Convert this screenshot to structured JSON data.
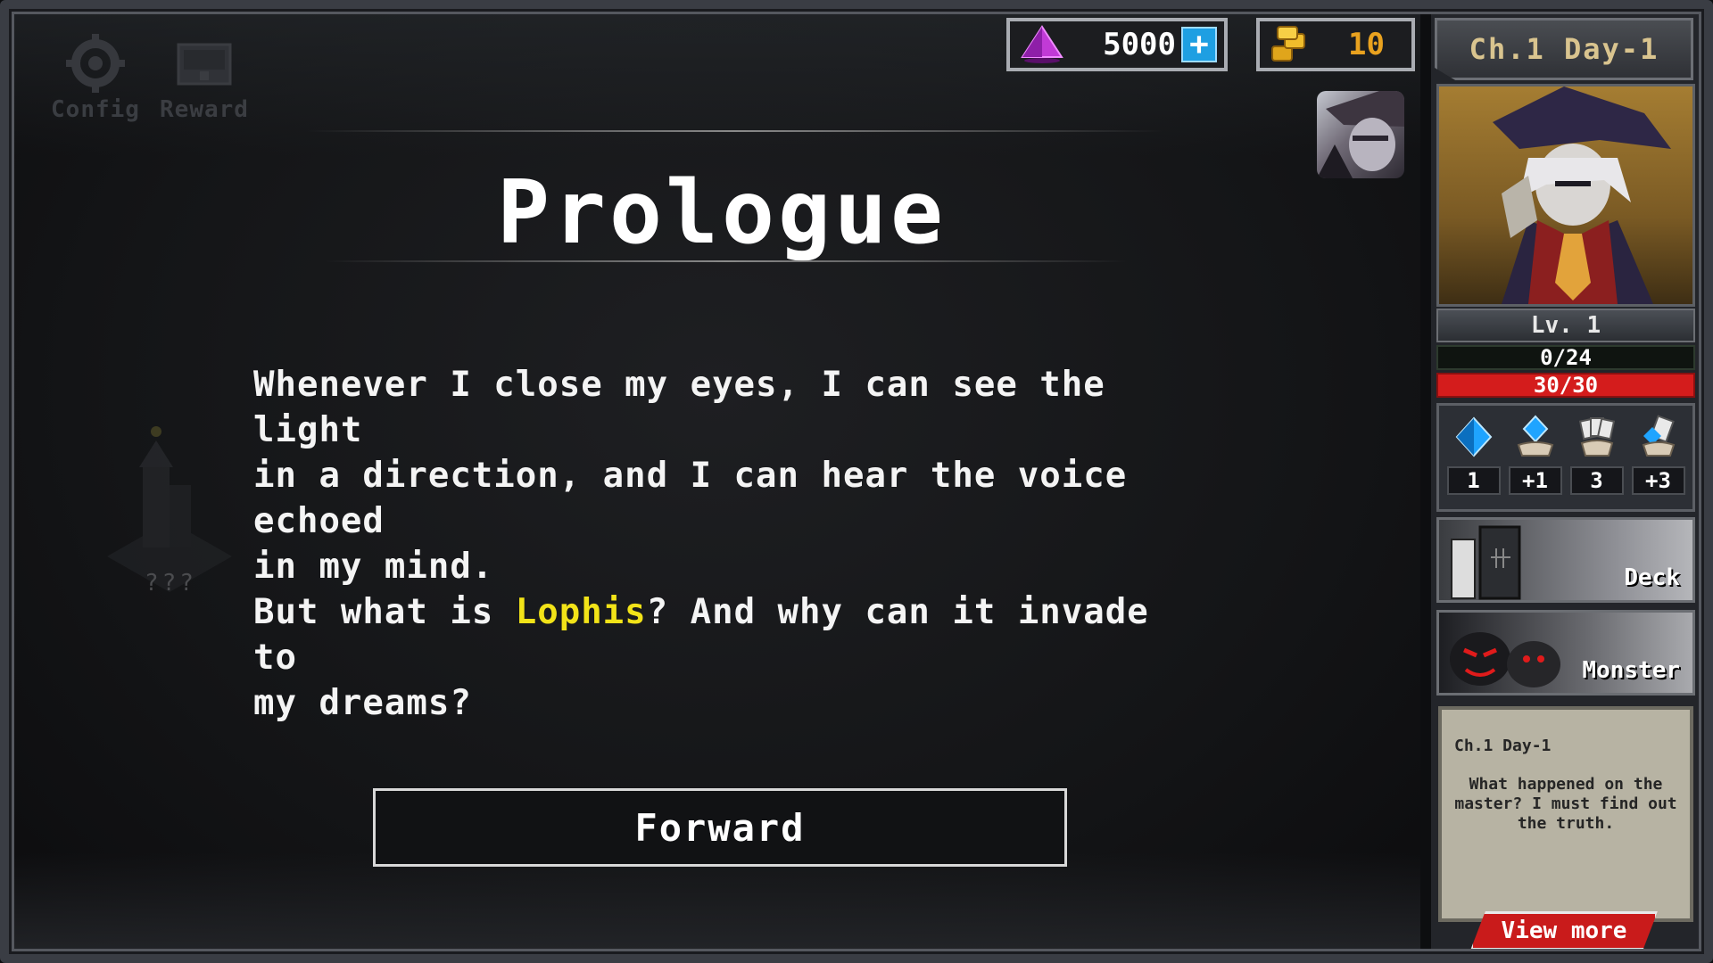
{
  "top_buttons": [
    {
      "label": "Config",
      "icon": "gear-icon"
    },
    {
      "label": "Reward",
      "icon": "treasure-chest-icon"
    }
  ],
  "currency": {
    "gems": {
      "value": "5000",
      "icon": "gem-icon"
    },
    "gold": {
      "value": "10",
      "icon": "gold-coins-icon"
    }
  },
  "dialog": {
    "title": "Prologue",
    "text_before": "Whenever I close my eyes, I can see the light\nin a direction, and I can hear the voice echoed\nin my mind.\nBut what is ",
    "highlight": "Lophis",
    "text_after": "? And why can it invade to\nmy dreams?",
    "forward_label": "Forward",
    "locked_label": "???"
  },
  "side_panel": {
    "chapter": "Ch.1 Day-1",
    "level": "Lv. 1",
    "exp": {
      "text": "0/24",
      "fraction": 0.0
    },
    "hp": {
      "text": "30/30",
      "fraction": 1.0
    },
    "resources": [
      {
        "icon": "blue-crystal-icon",
        "value": "1"
      },
      {
        "icon": "hand-crystal-icon",
        "value": "+1"
      },
      {
        "icon": "cards-in-hand-icon",
        "value": "3"
      },
      {
        "icon": "card-draw-icon",
        "value": "+3"
      }
    ],
    "deck_label": "Deck",
    "monster_label": "Monster",
    "quest": {
      "title": "Ch.1 Day-1",
      "description": "What happened on the master? I must find out the truth."
    },
    "view_more_label": "View more"
  },
  "colors": {
    "highlight": "#f2e318",
    "hp": "#d41c1c",
    "exp": "#1d7a22",
    "accent_blue": "#1e9fe2"
  }
}
